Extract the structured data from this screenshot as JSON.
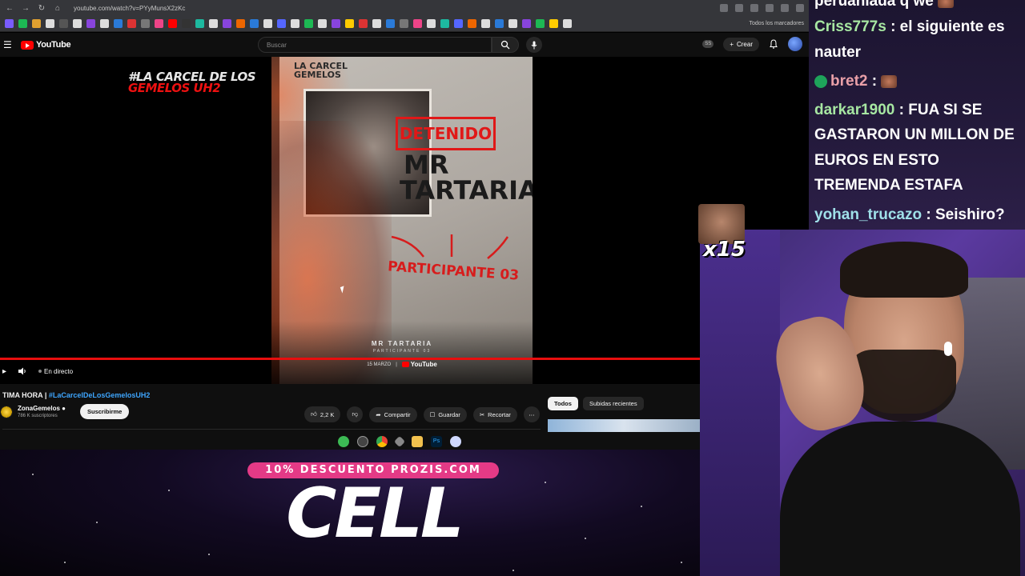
{
  "browser": {
    "url": "youtube.com/watch?v=PYyMunsX2zKc",
    "bookmarks_all_label": "Todos los marcadores"
  },
  "youtube": {
    "logo_text": "YouTube",
    "search_placeholder": "Buscar",
    "create_label": "Crear"
  },
  "player": {
    "channel_logo_line1": "#LA CARCEL DE LOS",
    "channel_logo_line2": "GEMELOS UH2",
    "live_label": "En directo",
    "poster": {
      "brand_line1": "LA CARCEL",
      "brand_line2": "GEMELOS",
      "stamp": "DETENIDO",
      "name_line1": "MR",
      "name_line2": "TARTARIA",
      "participant": "PARTICIPANTE 03",
      "footer_name": "MR TARTARIA",
      "footer_sub": "PARTICIPANTE 03",
      "footer_date": "15 MARZO",
      "footer_platform": "YouTube"
    }
  },
  "video": {
    "title_prefix": "TIMA HORA | ",
    "title_hashtag": "#LaCarcelDeLosGemelosUH2",
    "channel_name": "ZonaGemelos",
    "subscribers": "786 K suscriptores",
    "subscribe_label": "Suscribirme",
    "likes": "2,2 K",
    "share_label": "Compartir",
    "save_label": "Guardar",
    "clip_label": "Recortar"
  },
  "sidebar": {
    "chips": [
      "Todos",
      "Subidas recientes"
    ]
  },
  "sponsor": {
    "promo": "10% DESCUENTO PROZIS.COM",
    "product": "CELL"
  },
  "chat": {
    "messages": [
      {
        "user": "",
        "text": "peruaniada q we"
      },
      {
        "user": "Criss777s",
        "text": ": el siguiente es nauter"
      },
      {
        "user": "bret2",
        "text": ":"
      },
      {
        "user": "darkar1900",
        "text": ": FUA SI SE GASTARON UN MILLON DE EUROS EN ESTO TREMENDA ESTAFA"
      },
      {
        "user": "yohan_trucazo",
        "text": ": Seishiro?"
      }
    ],
    "chat_line1_a": "Criss777s",
    "chat_line1_b": " : el siguiente es",
    "chat_line1_c": "nauter",
    "darkar_1": " : FUA SI SE",
    "darkar_2": "GASTARON UN MILLON DE",
    "darkar_3": "EUROS EN ESTO",
    "darkar_4": "TREMENDA ESTAFA"
  },
  "combo": {
    "count": "x15"
  },
  "colors": {
    "yt_red": "#ff0000",
    "link_blue": "#3ea6ff",
    "promo_pink": "#e43a86"
  }
}
